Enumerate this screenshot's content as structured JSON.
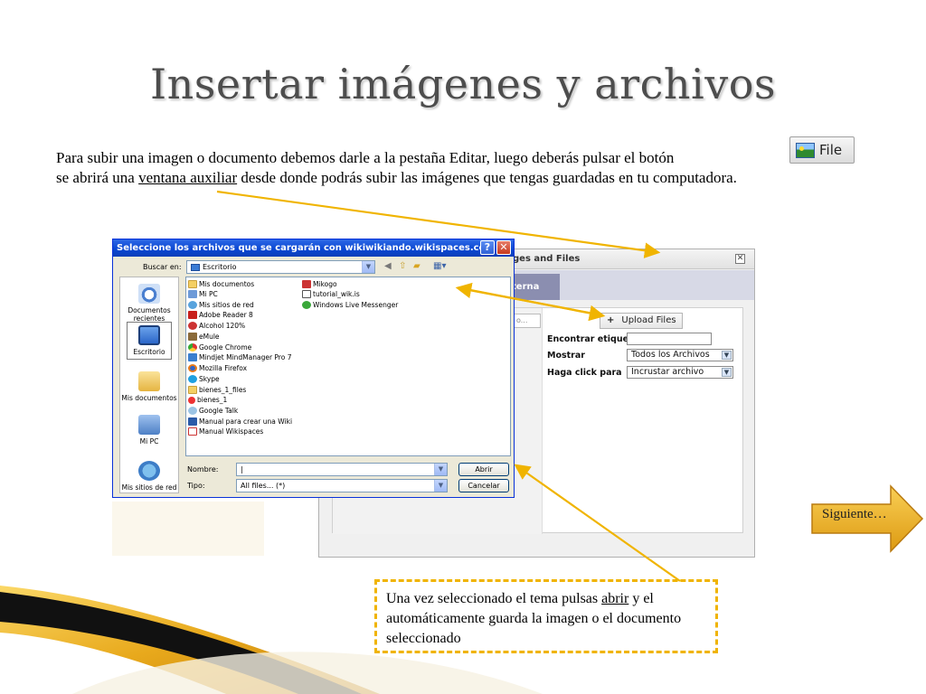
{
  "slide": {
    "title": "Insertar imágenes y archivos",
    "intro_line1": "Para subir una imagen o documento debemos darle a la pestaña Editar, luego deberás pulsar el botón",
    "intro_line2_pre": "se abrirá una ",
    "intro_line2_link": "ventana auxiliar",
    "intro_line2_post": " desde donde podrás subir las imágenes que tengas guardadas en tu computadora.",
    "file_button_label": "File"
  },
  "wiki_panel": {
    "header_fragment": "ges and Files",
    "close_glyph": "✕",
    "tab_fragment": "terna",
    "input_stub": "o...",
    "upload_button": "Upload Files",
    "upload_plus": "+",
    "tag_label": "Encontrar etiqueta",
    "tag_value": "",
    "show_label": "Mostrar",
    "show_value": "Todos los Archivos",
    "click_label": "Haga click para",
    "click_value": "Incrustar archivo"
  },
  "dialog": {
    "title": "Seleccione los archivos que se cargarán con wikiwikiando.wikispaces.com",
    "help": "?",
    "close": "✕",
    "look_in_label": "Buscar en:",
    "look_in_value": "Escritorio",
    "places": [
      "Documentos recientes",
      "Escritorio",
      "Mis documentos",
      "Mi PC",
      "Mis sitios de red"
    ],
    "files_col1": [
      "Mis documentos",
      "Mi PC",
      "Mis sitios de red",
      "Adobe Reader 8",
      "Alcohol 120%",
      "eMule",
      "Google Chrome",
      "Mindjet MindManager Pro 7",
      "Mozilla Firefox",
      "Skype",
      "bienes_1_files",
      "bienes_1",
      "Google Talk",
      "Manual para crear una Wiki",
      "Manual Wikispaces"
    ],
    "files_col2": [
      "Mikogo",
      "tutorial_wik.is",
      "Windows Live Messenger"
    ],
    "name_label": "Nombre:",
    "name_value": "|",
    "type_label": "Tipo:",
    "type_value": "All files... (*)",
    "open_button": "Abrir",
    "cancel_button": "Cancelar"
  },
  "callout": {
    "text_pre": "Una vez seleccionado el tema pulsas ",
    "text_link": "abrir",
    "text_post": "  y el automáticamente guarda la imagen o el documento seleccionado"
  },
  "next_button": {
    "label": "Siguiente…"
  },
  "colors": {
    "arrow": "#f0b400",
    "title": "#4d4d4d",
    "xp_blue": "#0a46d1",
    "next_fill": "#f2b21c"
  },
  "icons": [
    "image-icon",
    "folder-icon",
    "recent-docs-icon",
    "desktop-icon",
    "my-documents-icon",
    "my-computer-icon",
    "network-icon",
    "back-icon",
    "up-folder-icon",
    "new-folder-icon",
    "views-icon"
  ]
}
